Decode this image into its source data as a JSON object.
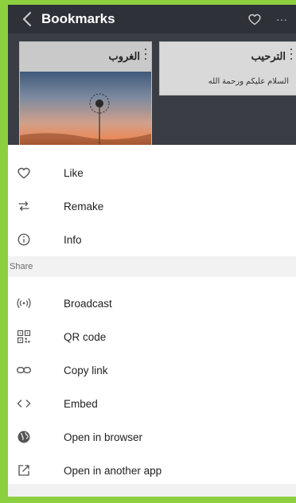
{
  "header": {
    "title": "Bookmarks"
  },
  "cards": [
    {
      "title": "الغروب",
      "subtitle": ""
    },
    {
      "title": "الترحيب",
      "subtitle": "السلام عليكم ورحمة الله"
    }
  ],
  "menu": {
    "top_items": [
      {
        "label": "Like",
        "icon": "heart-outline-icon"
      },
      {
        "label": "Remake",
        "icon": "remake-icon"
      },
      {
        "label": "Info",
        "icon": "info-icon"
      }
    ],
    "share_section_label": "Share",
    "share_items": [
      {
        "label": "Broadcast",
        "icon": "broadcast-icon"
      },
      {
        "label": "QR code",
        "icon": "qr-code-icon"
      },
      {
        "label": "Copy link",
        "icon": "link-icon"
      },
      {
        "label": "Embed",
        "icon": "embed-icon"
      },
      {
        "label": "Open in browser",
        "icon": "globe-icon"
      },
      {
        "label": "Open in another app",
        "icon": "open-external-icon"
      }
    ]
  }
}
